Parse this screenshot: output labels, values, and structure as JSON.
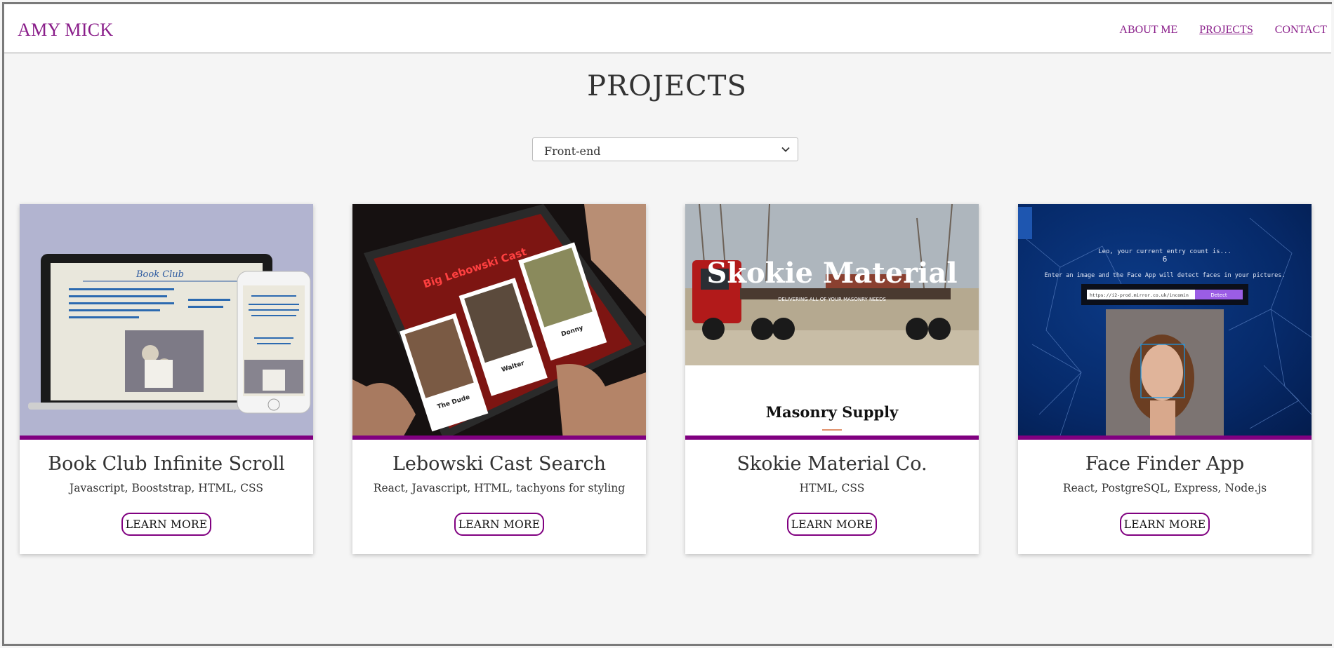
{
  "header": {
    "brand": "AMY MICK",
    "nav": [
      "ABOUT ME",
      "PROJECTS",
      "CONTACT"
    ]
  },
  "page_title": "PROJECTS",
  "filter": {
    "selected": "Front-end"
  },
  "projects": [
    {
      "title": "Book Club Infinite Scroll",
      "tech": "Javascript, Booststrap, HTML, CSS",
      "button": "LEARN MORE",
      "thumb_text": {
        "heading": "Book Club"
      }
    },
    {
      "title": "Lebowski Cast Search",
      "tech": "React, Javascript, HTML, tachyons for styling",
      "button": "LEARN MORE",
      "thumb_text": {
        "heading": "Big Lebowski Cast",
        "cards": [
          "The Dude",
          "Walter",
          "Donny"
        ]
      }
    },
    {
      "title": "Skokie Material Co.",
      "tech": "HTML, CSS",
      "button": "LEARN MORE",
      "thumb_text": {
        "heading": "Skokie Material",
        "sub": "DELIVERING ALL OF YOUR MASONRY NEEDS",
        "footer": "Masonry Supply"
      }
    },
    {
      "title": "Face Finder App",
      "tech": "React, PostgreSQL, Express, Node.js",
      "button": "LEARN MORE",
      "thumb_text": {
        "line1": "Leo, your current entry count is...",
        "count": "6",
        "line2": "Enter an image and the Face App will detect faces in your pictures.",
        "url": "https://i2-prod.mirror.co.uk/incomin",
        "detect": "Detect"
      }
    }
  ],
  "colors": {
    "accent": "#800080",
    "brand": "#8a1e8a",
    "background": "#f5f5f5"
  }
}
